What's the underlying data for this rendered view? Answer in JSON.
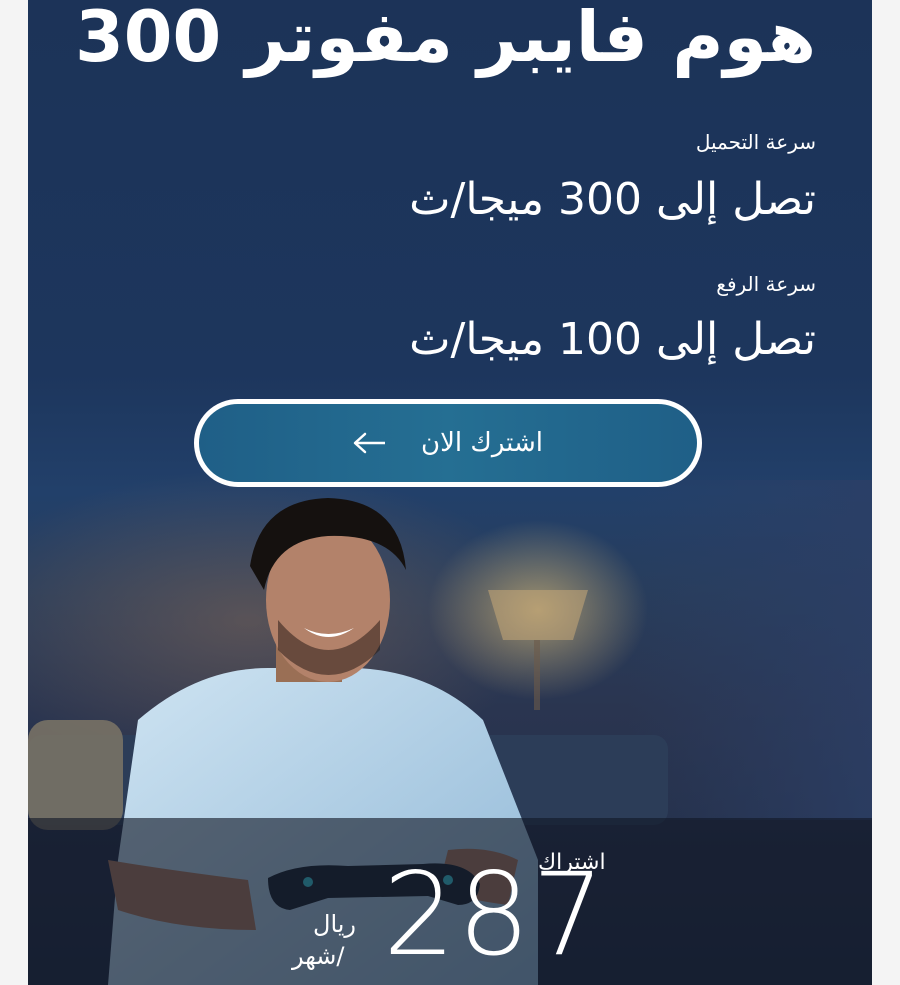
{
  "plan": {
    "title": "هوم فايبر مفوتر 300",
    "download": {
      "label": "سرعة التحميل",
      "value": "تصل إلى 300 ميجا/ث"
    },
    "upload": {
      "label": "سرعة الرفع",
      "value": "تصل إلى 100 ميجا/ث"
    },
    "cta": {
      "label": "اشترك الان",
      "icon": "arrow-left-icon"
    }
  },
  "pricing": {
    "label": "اشتراك",
    "amount": "287",
    "currency": "ريال",
    "period": "/شهر"
  },
  "colors": {
    "background": "#1d365d",
    "button": "#256f93",
    "text": "#ffffff"
  }
}
